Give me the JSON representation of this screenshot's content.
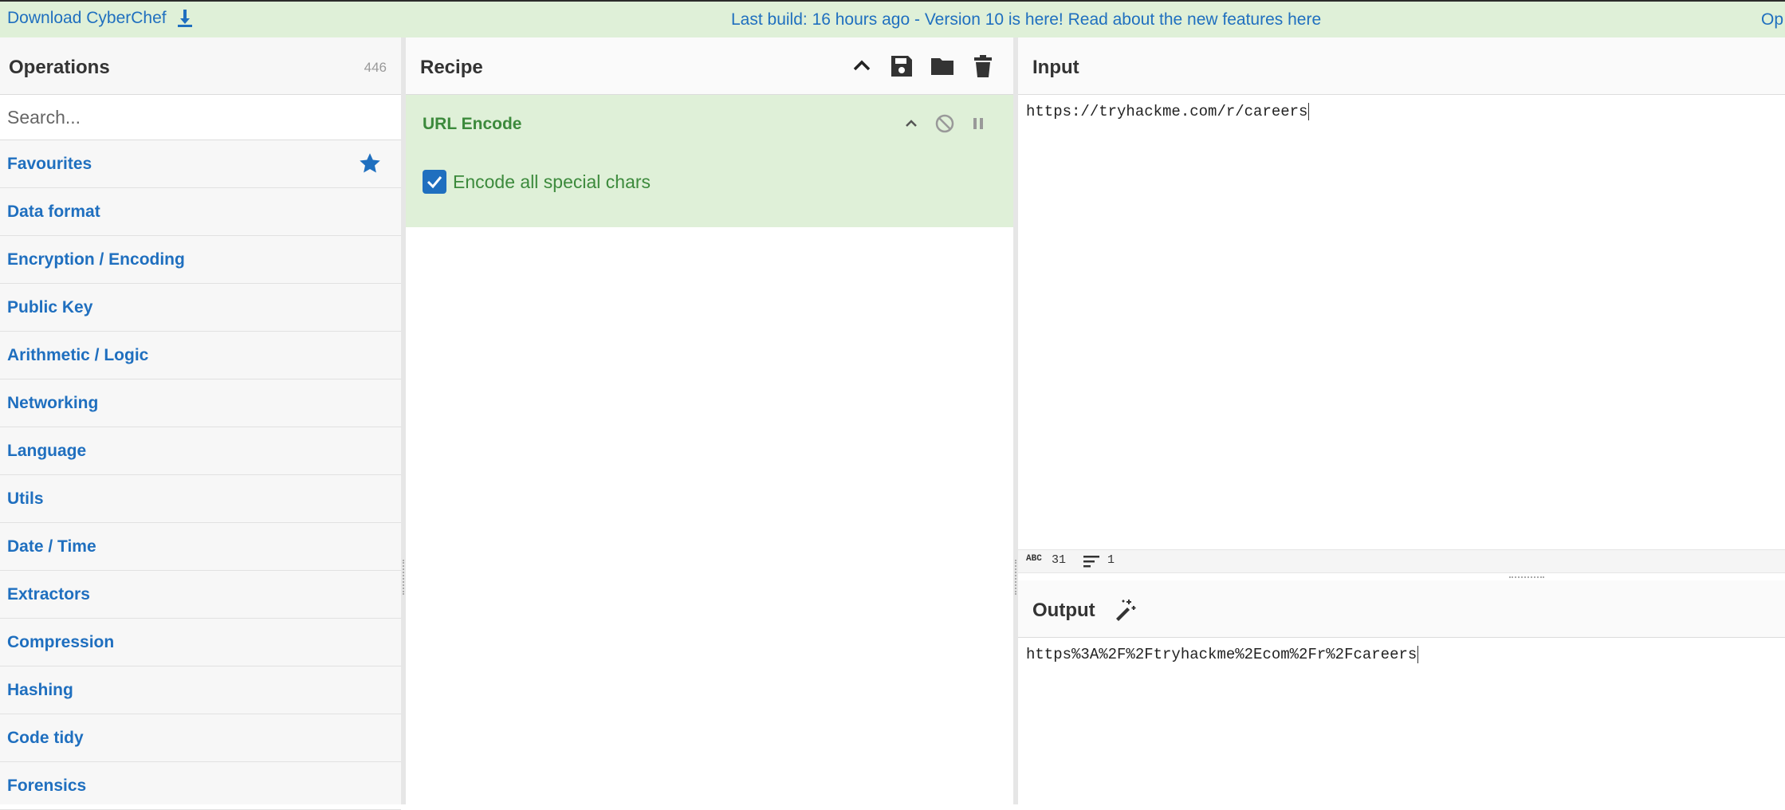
{
  "banner": {
    "download_label": "Download CyberChef",
    "message": "Last build: 16 hours ago - Version 10 is here! Read about the new features here",
    "right_text": "Op"
  },
  "operations": {
    "title": "Operations",
    "count": "446",
    "search_placeholder": "Search...",
    "categories": [
      "Favourites",
      "Data format",
      "Encryption / Encoding",
      "Public Key",
      "Arithmetic / Logic",
      "Networking",
      "Language",
      "Utils",
      "Date / Time",
      "Extractors",
      "Compression",
      "Hashing",
      "Code tidy",
      "Forensics"
    ]
  },
  "recipe": {
    "title": "Recipe",
    "operation": {
      "name": "URL Encode",
      "option_label": "Encode all special chars",
      "option_checked": true
    }
  },
  "input": {
    "title": "Input",
    "value": "https://tryhackme.com/r/careers",
    "length": "31",
    "lines": "1"
  },
  "output": {
    "title": "Output",
    "value": "https%3A%2F%2Ftryhackme%2Ecom%2Fr%2Fcareers"
  },
  "colors": {
    "accent": "#1f6fbf",
    "banner_bg": "#dff0d8",
    "op_green": "#3c8a3c"
  }
}
